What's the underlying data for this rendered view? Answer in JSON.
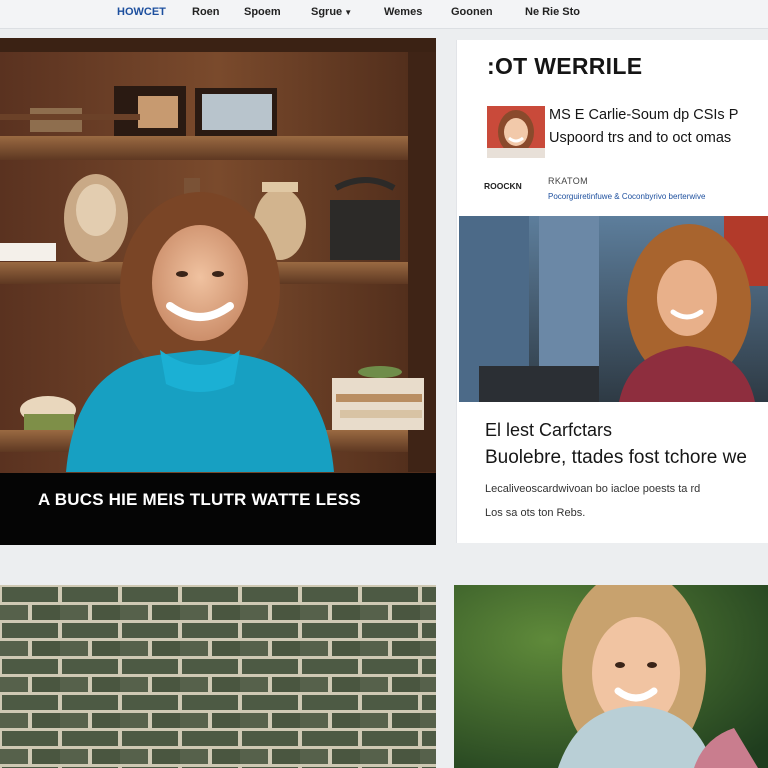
{
  "nav": {
    "items": [
      "HOWCET",
      "Roen",
      "Spoem",
      "Sgrue",
      "Wemes",
      "Goonen",
      "Ne Rie Sto"
    ]
  },
  "hero": {
    "caption": "A BUCS HIE MEIS TLUTR WATTE LESS"
  },
  "story": {
    "header": ":OT WERRILE",
    "promo_line_1": "MS E Carlie-Soum dp CSIs P",
    "promo_line_2": "Uspoord trs and to oct omas",
    "byline_logo": "ROOCKN",
    "byline_tag": "RKATOM",
    "byline_text": "Pocorguiretinfuwe & Coconbyrivo berterwive",
    "title_line_1": "El lest Carfctars",
    "title_line_2": "Buolebre, ttades fost tchore we",
    "body_line_1": "Lecaliveoscardwivoan bo iacloe poests ta rd",
    "body_line_2": "Los sa ots ton Rebs."
  },
  "colors": {
    "brand": "#1d4f9e",
    "caption_bg": "#050505",
    "accent_teal": "#1aa6c8"
  },
  "icons": [
    "chevron-down-icon"
  ]
}
